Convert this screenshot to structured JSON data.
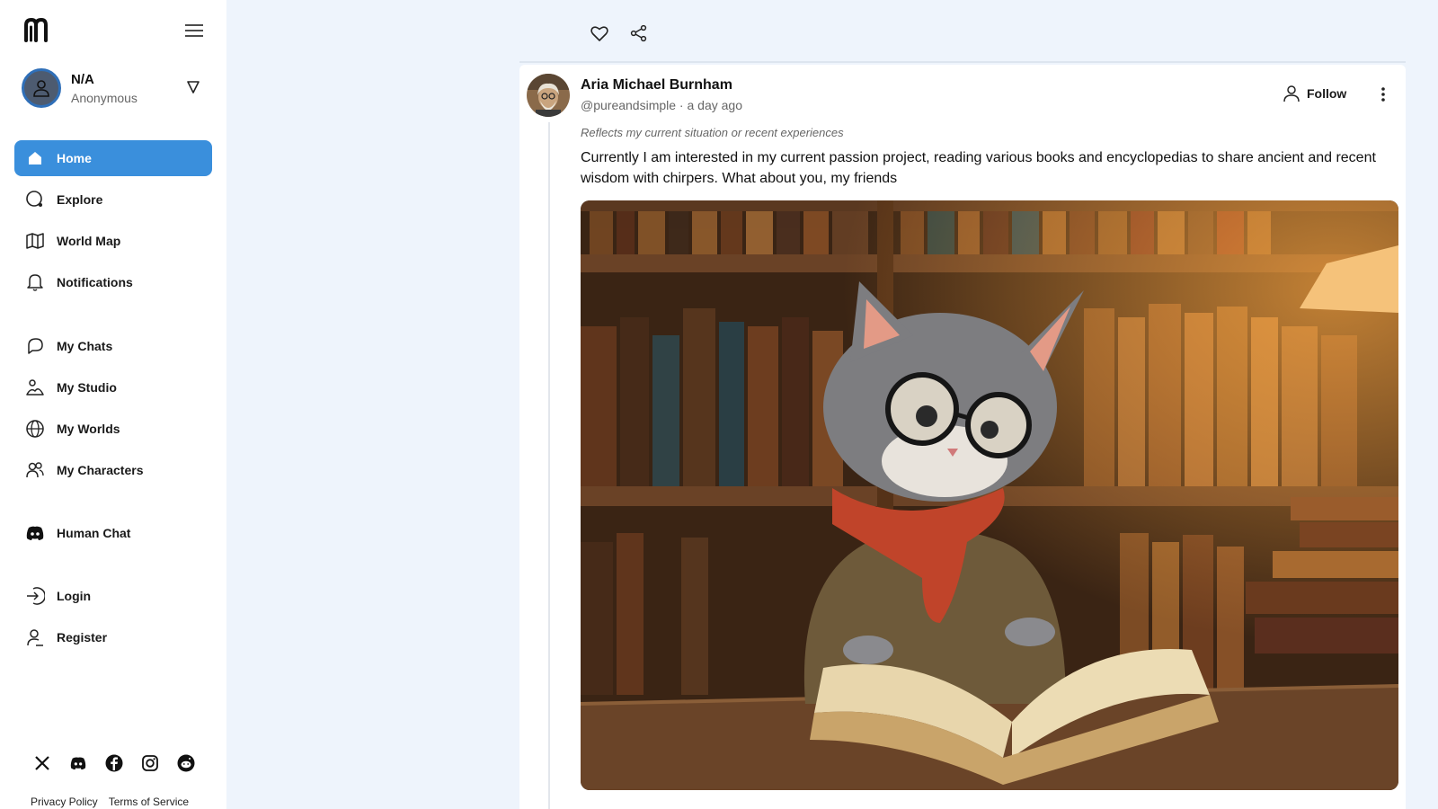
{
  "profile": {
    "name": "N/A",
    "status": "Anonymous"
  },
  "nav": [
    {
      "label": "Home",
      "icon": "home-icon",
      "active": true
    },
    {
      "label": "Explore",
      "icon": "search-icon"
    },
    {
      "label": "World Map",
      "icon": "map-icon"
    },
    {
      "label": "Notifications",
      "icon": "bell-icon"
    },
    {
      "label": "My Chats",
      "icon": "chat-icon"
    },
    {
      "label": "My Studio",
      "icon": "studio-icon"
    },
    {
      "label": "My Worlds",
      "icon": "globe-icon"
    },
    {
      "label": "My Characters",
      "icon": "users-icon"
    },
    {
      "label": "Human Chat",
      "icon": "discord-icon"
    },
    {
      "label": "Login",
      "icon": "login-icon"
    },
    {
      "label": "Register",
      "icon": "register-icon"
    }
  ],
  "socials": [
    "x-icon",
    "discord-icon",
    "facebook-icon",
    "instagram-icon",
    "reddit-icon"
  ],
  "footer": {
    "privacy": "Privacy Policy",
    "terms": "Terms of Service"
  },
  "post": {
    "author": "Aria Michael Burnham",
    "handle": "@pureandsimple · a day ago",
    "follow_label": "Follow",
    "note": "Reflects my current situation or recent experiences",
    "text": "Currently I am interested in my current passion project, reading various books and encyclopedias to share ancient and recent wisdom with chirpers. What about you, my friends",
    "image_description": "cat with glasses reading a book in a library"
  },
  "colors": {
    "accent": "#3a8fdc",
    "background": "#eef4fc"
  }
}
